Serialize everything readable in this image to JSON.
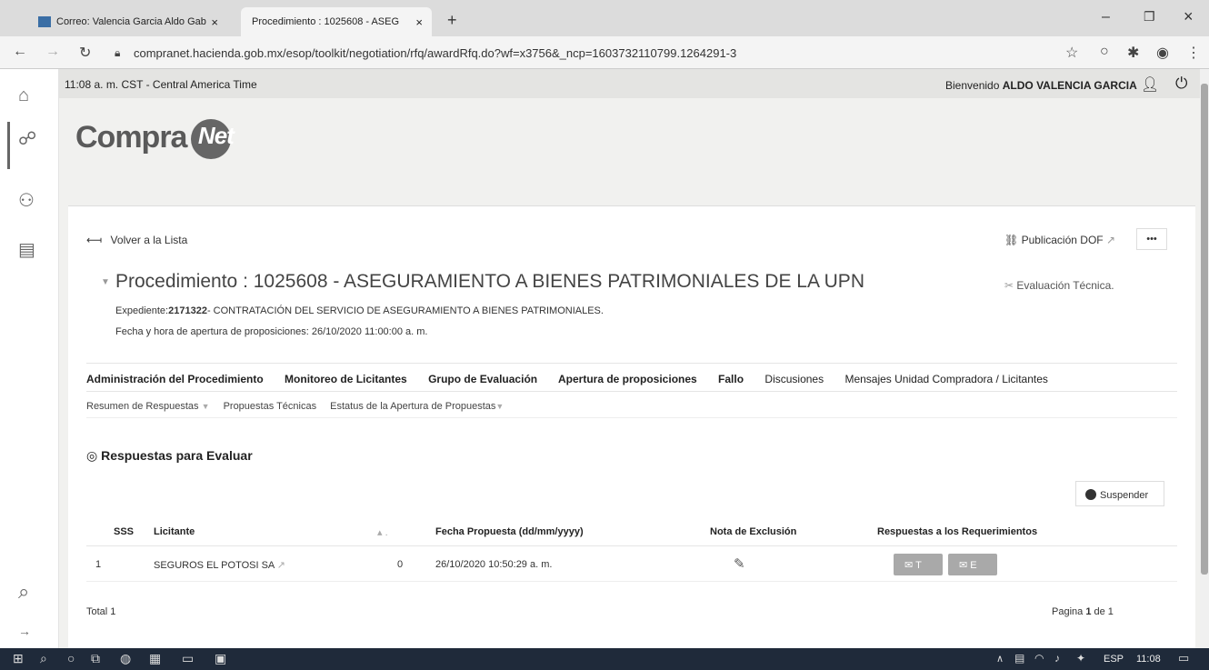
{
  "browser": {
    "tabs": [
      {
        "label": "Correo: Valencia Garcia Aldo Gab",
        "close": "×"
      },
      {
        "label": "Procedimiento : 1025608 - ASEG",
        "close": "×"
      }
    ],
    "new_tab": "+",
    "url": "compranet.hacienda.gob.mx/esop/toolkit/negotiation/rfq/awardRfq.do?wf=x3756&_ncp=1603732110799.1264291-3",
    "window_controls": {
      "minimize": "–",
      "restore": "❐",
      "close": "×"
    }
  },
  "header": {
    "time": "11:08 a. m. CST - Central America Time",
    "welcome_prefix": "Bienvenido",
    "user_name": "ALDO VALENCIA GARCIA"
  },
  "logo": {
    "text_left": "Compra",
    "text_right": "Net"
  },
  "toolbar": {
    "back_label": "Volver a la Lista",
    "publicacion_label": "Publicación DOF",
    "more_label": "•••"
  },
  "procedure": {
    "title": "Procedimiento : 1025608 - ASEGURAMIENTO A BIENES PATRIMONIALES DE LA UPN",
    "expediente_label": "Expediente:",
    "expediente_number": "2171322",
    "expediente_desc": "- CONTRATACIÓN DEL SERVICIO DE ASEGURAMIENTO A BIENES PATRIMONIALES.",
    "fecha_line": "Fecha y hora de apertura de proposiciones: 26/10/2020 11:00:00 a. m.",
    "evaluacion_label": "Evaluación Técnica."
  },
  "main_tabs": [
    "Administración del Procedimiento",
    "Monitoreo de Licitantes",
    "Grupo de Evaluación",
    "Apertura de proposiciones",
    "Fallo",
    "Discusiones",
    "Mensajes Unidad Compradora / Licitantes"
  ],
  "sub_tabs": [
    "Resumen de Respuestas",
    "Propuestas Técnicas",
    "Estatus de la Apertura de Propuestas"
  ],
  "section": {
    "title": "Respuestas para Evaluar",
    "suspend_label": "Suspender"
  },
  "table": {
    "headers": [
      "SSS",
      "Licitante",
      "",
      "Fecha Propuesta (dd/mm/yyyy)",
      "Nota de Exclusión",
      "Respuestas a los Requerimientos"
    ],
    "rows": [
      {
        "sss": "1",
        "licitante": "SEGUROS EL POTOSI SA",
        "count": "0",
        "fecha": "26/10/2020 10:50:29 a. m.",
        "btn_t": "T",
        "btn_e": "E"
      }
    ],
    "total": "Total 1",
    "pagination_prefix": "Pagina",
    "pagination_page": "1",
    "pagination_suffix": "de 1"
  },
  "taskbar": {
    "lang": "ESP",
    "time": "11:08"
  },
  "colors": {
    "accent_dark": "#222222",
    "button_gray": "#a9a9a9",
    "taskbar": "#1f2a3a"
  }
}
